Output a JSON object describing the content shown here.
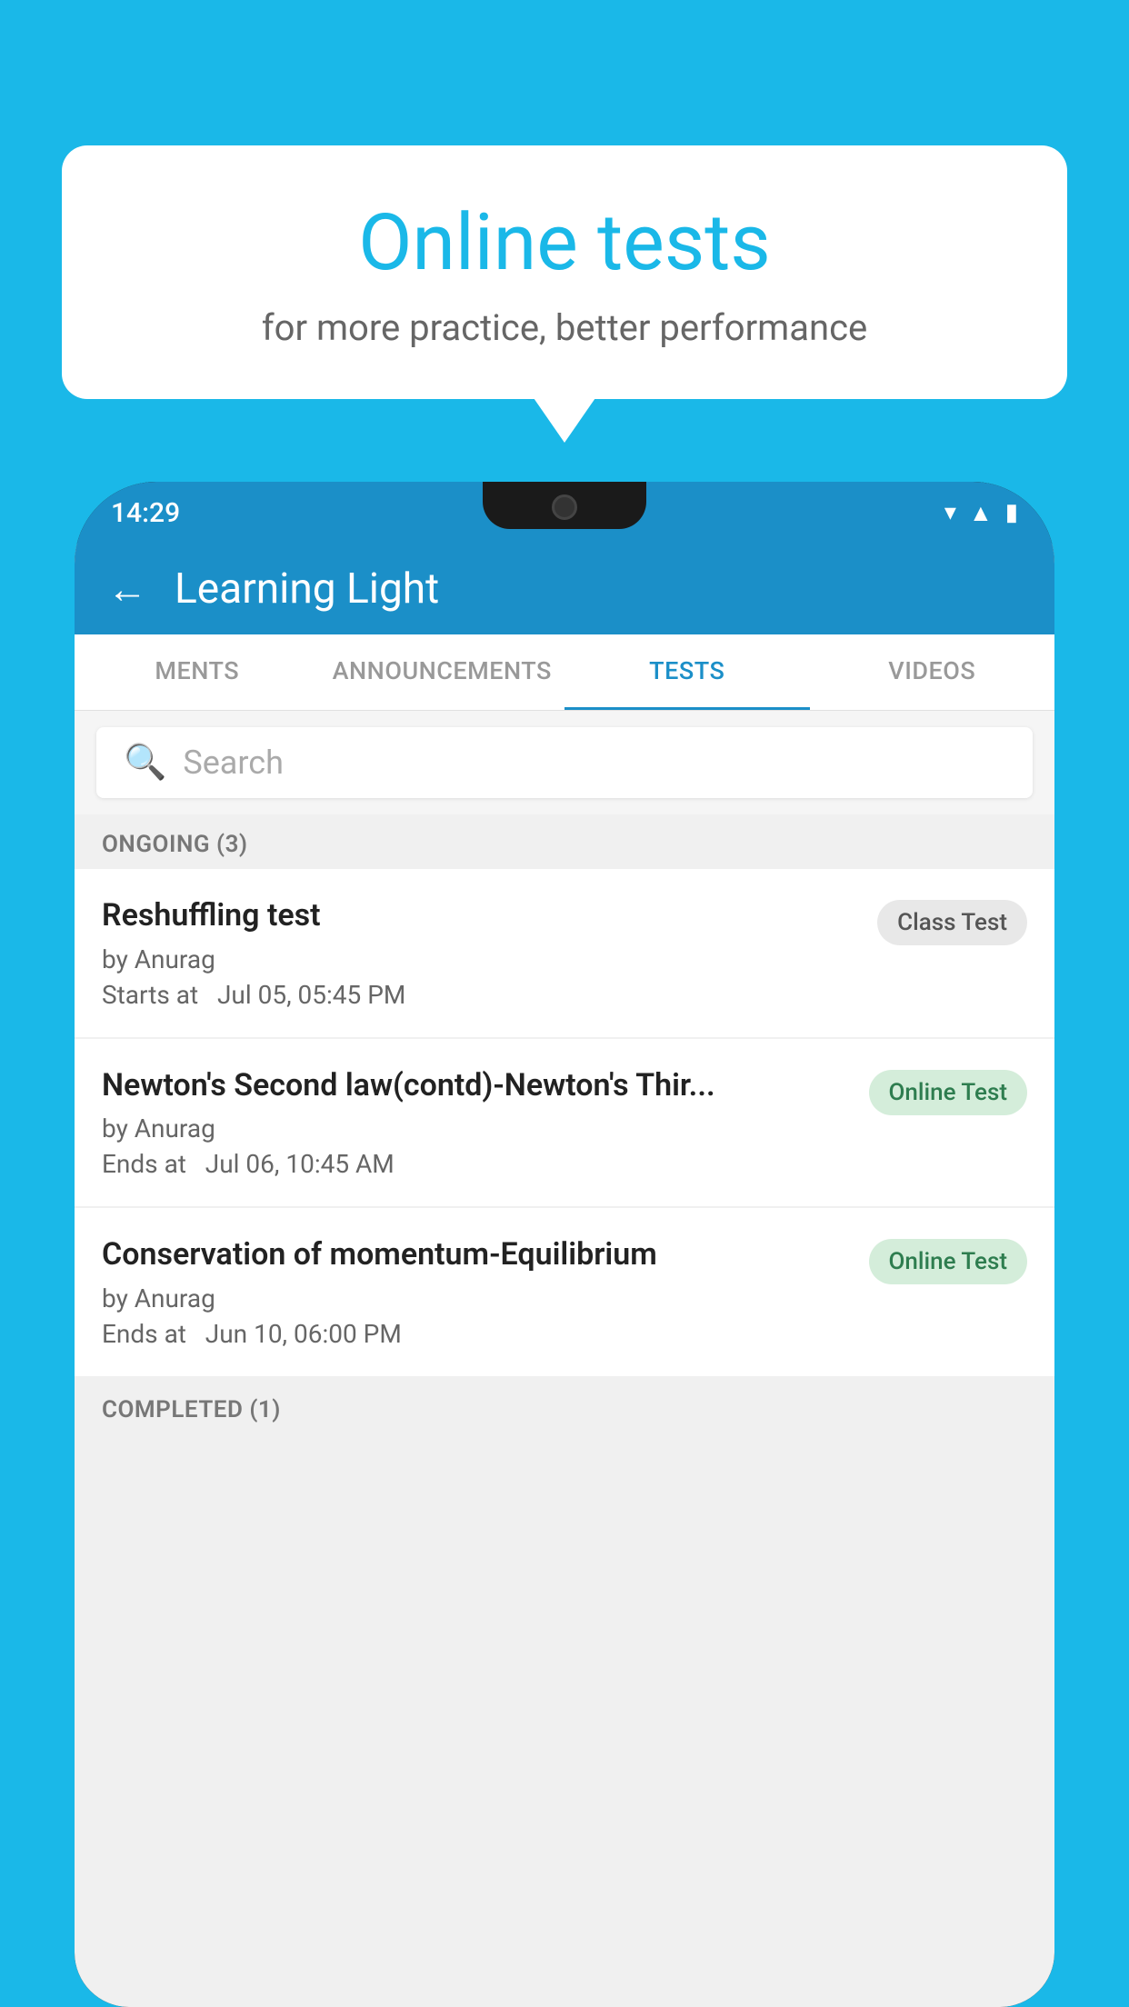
{
  "background": {
    "color": "#1ab8e8"
  },
  "speech_bubble": {
    "title": "Online tests",
    "subtitle": "for more practice, better performance"
  },
  "status_bar": {
    "time": "14:29",
    "icons": [
      "wifi",
      "signal",
      "battery"
    ]
  },
  "app_bar": {
    "back_label": "←",
    "title": "Learning Light"
  },
  "tabs": [
    {
      "label": "MENTS",
      "active": false
    },
    {
      "label": "ANNOUNCEMENTS",
      "active": false
    },
    {
      "label": "TESTS",
      "active": true
    },
    {
      "label": "VIDEOS",
      "active": false
    }
  ],
  "search": {
    "placeholder": "Search"
  },
  "section_ongoing": {
    "label": "ONGOING (3)"
  },
  "tests": [
    {
      "title": "Reshuffling test",
      "by": "by Anurag",
      "date_label": "Starts at",
      "date": "Jul 05, 05:45 PM",
      "badge": "Class Test",
      "badge_type": "class"
    },
    {
      "title": "Newton's Second law(contd)-Newton's Thir...",
      "by": "by Anurag",
      "date_label": "Ends at",
      "date": "Jul 06, 10:45 AM",
      "badge": "Online Test",
      "badge_type": "online"
    },
    {
      "title": "Conservation of momentum-Equilibrium",
      "by": "by Anurag",
      "date_label": "Ends at",
      "date": "Jun 10, 06:00 PM",
      "badge": "Online Test",
      "badge_type": "online"
    }
  ],
  "section_completed": {
    "label": "COMPLETED (1)"
  }
}
